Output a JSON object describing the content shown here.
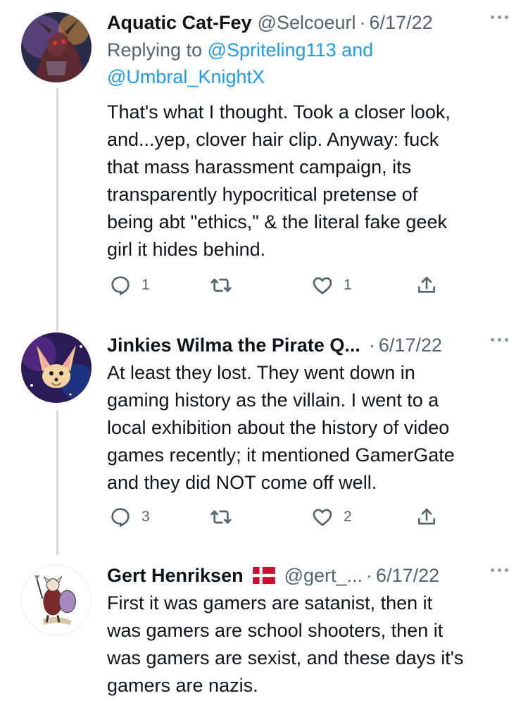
{
  "tweets": [
    {
      "name": "Aquatic Cat-Fey",
      "handle": "@Selcoeurl",
      "separator": "·",
      "date": "6/17/22",
      "reply_prefix": "Replying to ",
      "reply_mention_1": "@Spriteling113",
      "reply_and": " and",
      "reply_mention_2": "@Umbral_KnightX",
      "text_lines": [
        "That's what I thought. Took a closer look,",
        "and...yep, clover hair clip. Anyway: fuck",
        "that mass harassment campaign, its",
        "transparently hypocritical pretense of",
        "being abt \"ethics,\" & the literal fake geek",
        "girl it hides behind."
      ],
      "replies": "1",
      "retweets": "",
      "likes": "1"
    },
    {
      "name": "Jinkies Wilma the Pirate Q...",
      "handle": "",
      "separator": "·",
      "date": "6/17/22",
      "text_lines": [
        "At least they lost. They went down in",
        "gaming history as the villain. I went to a",
        "local exhibition about the history of video",
        "games recently; it mentioned GamerGate",
        "and they did NOT come off well."
      ],
      "replies": "3",
      "retweets": "",
      "likes": "2"
    },
    {
      "name": "Gert Henriksen",
      "flag": "denmark-flag",
      "handle": "@gert_...",
      "separator": "·",
      "date": "6/17/22",
      "text_lines": [
        "First it was gamers are satanist, then it",
        "was gamers are school shooters, then it",
        "was gamers are sexist, and these days it's",
        "gamers are nazis."
      ]
    }
  ],
  "colors": {
    "text": "#0f1419",
    "secondary": "#536471",
    "link": "#1d9bf0",
    "thread_line": "#cfd9de"
  },
  "icons": [
    "reply-icon",
    "retweet-icon",
    "like-icon",
    "share-icon",
    "more-icon"
  ]
}
